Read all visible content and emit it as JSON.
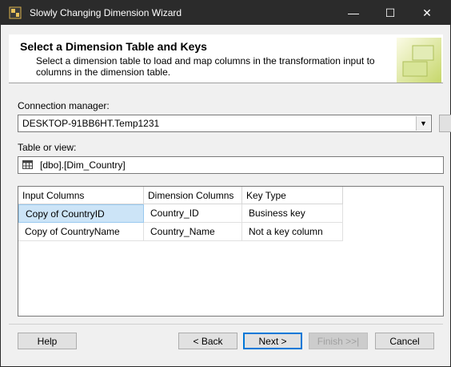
{
  "window": {
    "title": "Slowly Changing Dimension Wizard",
    "controls": {
      "minimize": "—",
      "maximize": "☐",
      "close": "✕"
    }
  },
  "header": {
    "title": "Select a Dimension Table and Keys",
    "description": "Select a dimension table to load and map columns in the transformation input to columns in the dimension table."
  },
  "connection": {
    "label": "Connection manager:",
    "value": "DESKTOP-91BB6HT.Temp1231"
  },
  "table": {
    "label": "Table or view:",
    "value": "[dbo].[Dim_Country]"
  },
  "grid": {
    "columns": [
      "Input Columns",
      "Dimension Columns",
      "Key Type"
    ],
    "rows": [
      {
        "input": "Copy of CountryID",
        "dimension": "Country_ID",
        "key_type": "Business key"
      },
      {
        "input": "Copy of CountryName",
        "dimension": "Country_Name",
        "key_type": "Not a key column"
      }
    ]
  },
  "buttons": {
    "help": "Help",
    "back": "< Back",
    "next": "Next >",
    "finish": "Finish >>|",
    "cancel": "Cancel"
  },
  "colors": {
    "titlebar": "#2b2b2b",
    "selection": "#cce4f7",
    "accent": "#0078d7"
  }
}
